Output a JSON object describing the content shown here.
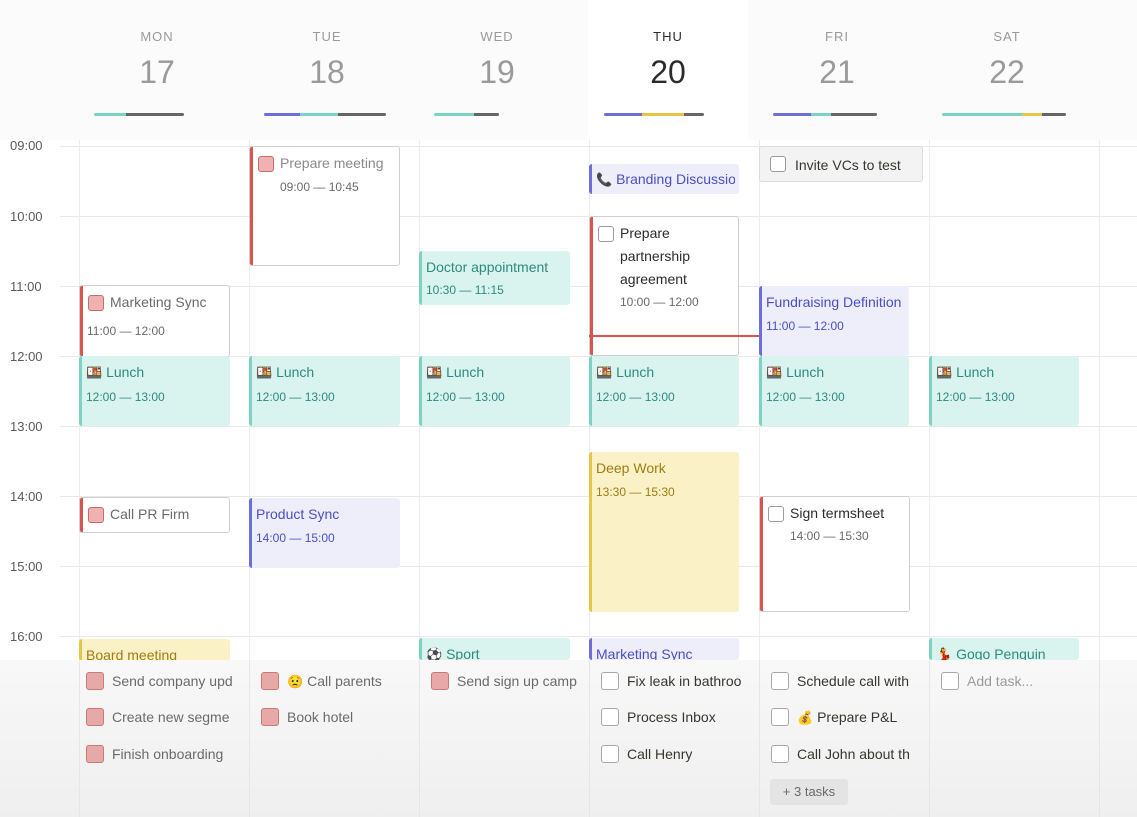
{
  "days": [
    {
      "name": "MON",
      "num": "17"
    },
    {
      "name": "TUE",
      "num": "18"
    },
    {
      "name": "WED",
      "num": "19"
    },
    {
      "name": "THU",
      "num": "20"
    },
    {
      "name": "FRI",
      "num": "21"
    },
    {
      "name": "SAT",
      "num": "22"
    }
  ],
  "times": [
    "09:00",
    "10:00",
    "11:00",
    "12:00",
    "13:00",
    "14:00",
    "15:00",
    "16:00"
  ],
  "colors": {
    "teal": "#7cd3c4",
    "blue": "#6c6fd9",
    "yellow": "#e6c54b",
    "red": "#d9534f",
    "gray": "#666666"
  },
  "events": {
    "mon_marketing": {
      "title": "Marketing Sync",
      "time": "11:00 — 12:00"
    },
    "mon_lunch": {
      "title": "Lunch",
      "time": "12:00 — 13:00",
      "icon": "bento-icon"
    },
    "mon_callpr": {
      "title": "Call PR Firm"
    },
    "mon_board": {
      "title": "Board meeting"
    },
    "tue_prepare": {
      "title": "Prepare meeting",
      "time": "09:00 — 10:45"
    },
    "tue_lunch": {
      "title": "Lunch",
      "time": "12:00 — 13:00",
      "icon": "bento-icon"
    },
    "tue_product": {
      "title": "Product Sync",
      "time": "14:00 — 15:00"
    },
    "wed_doctor": {
      "title": "Doctor appointment",
      "time": "10:30 — 11:15"
    },
    "wed_lunch": {
      "title": "Lunch",
      "time": "12:00 — 13:00",
      "icon": "bento-icon"
    },
    "wed_sport": {
      "title": "Sport",
      "icon": "soccer-icon"
    },
    "thu_branding": {
      "title": "Branding Discussion",
      "icon": "phone-icon"
    },
    "thu_partnership": {
      "title": "Prepare partnership agreement",
      "line1": "Prepare",
      "line2": "partnership",
      "line3": "agreement",
      "time": "10:00 — 12:00"
    },
    "thu_lunch": {
      "title": "Lunch",
      "time": "12:00 — 13:00",
      "icon": "bento-icon"
    },
    "thu_deepwork": {
      "title": "Deep Work",
      "time": "13:30 — 15:30"
    },
    "thu_marketing": {
      "title": "Marketing Sync"
    },
    "fri_invite": {
      "title": "Invite VCs to test"
    },
    "fri_fundraising": {
      "title": "Fundraising Definition",
      "time": "11:00 — 12:00"
    },
    "fri_lunch": {
      "title": "Lunch",
      "time": "12:00 — 13:00",
      "icon": "bento-icon"
    },
    "fri_termsheet": {
      "title": "Sign termsheet",
      "time": "14:00 — 15:30"
    },
    "sat_lunch": {
      "title": "Lunch",
      "time": "12:00 — 13:00",
      "icon": "bento-icon"
    },
    "sat_gogo": {
      "title": "Gogo Penguin",
      "icon": "dance-icon"
    }
  },
  "tasks": {
    "mon": [
      "Send company upd",
      "Create new segme",
      "Finish onboarding"
    ],
    "tue": [
      "Call parents",
      "Book hotel"
    ],
    "wed": [
      "Send sign up camp"
    ],
    "thu": [
      "Fix leak in bathroo",
      "Process Inbox",
      "Call Henry"
    ],
    "fri": [
      "Schedule call with",
      "Prepare P&L",
      "Call John about th"
    ],
    "sat_add": "Add task...",
    "more": "+ 3 tasks"
  }
}
